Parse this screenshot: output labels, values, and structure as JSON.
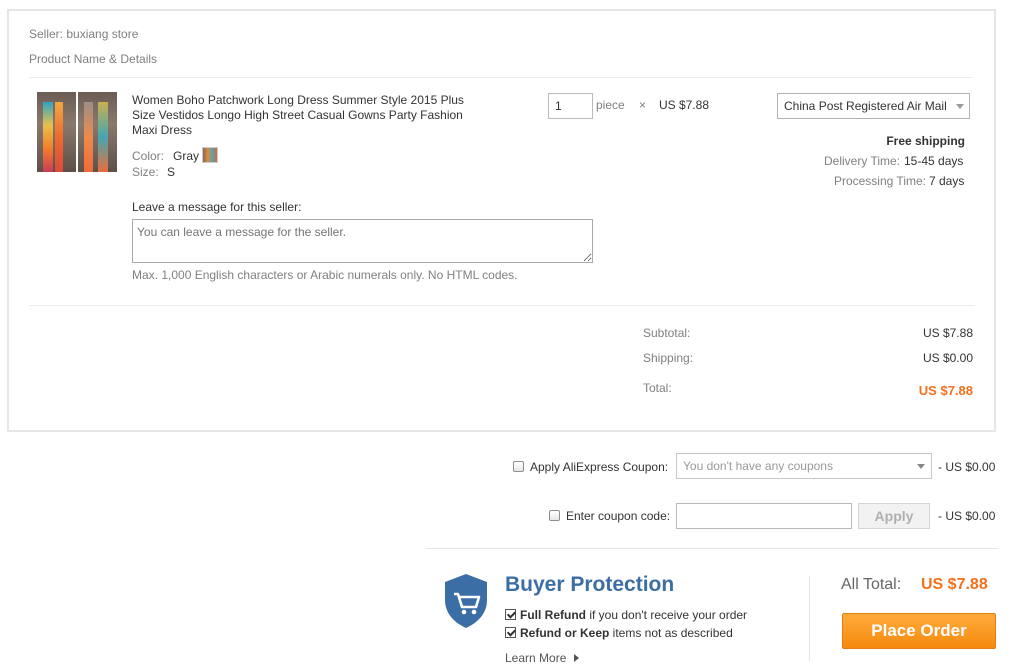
{
  "seller": {
    "label": "Seller: buxiang store"
  },
  "section": {
    "product_header": "Product Name & Details"
  },
  "product": {
    "title_lines": [
      "Women Boho Patchwork Long Dress Summer Style 2015 Plus",
      "Size Vestidos Longo High Street Casual Gowns Party Fashion",
      "Maxi Dress"
    ],
    "color_label": "Color:",
    "color_value": "Gray",
    "size_label": "Size:",
    "size_value": "S",
    "quantity": "1",
    "unit": "piece",
    "times": "×",
    "price": "US $7.88"
  },
  "shipping": {
    "method": "China Post Registered Air Mail",
    "free_text": "Free shipping",
    "delivery_label": "Delivery Time:",
    "delivery_value": "15-45 days",
    "processing_label": "Processing Time:",
    "processing_value": "7 days"
  },
  "message": {
    "label": "Leave a message for this seller:",
    "placeholder": "You can leave a message for the seller.",
    "note": "Max. 1,000 English characters or Arabic numerals only. No HTML codes."
  },
  "summary": {
    "subtotal_label": "Subtotal:",
    "subtotal_value": "US $7.88",
    "shipping_label": "Shipping:",
    "shipping_value": "US $0.00",
    "total_label": "Total:",
    "total_value": "US $7.88"
  },
  "coupon": {
    "aliexpress_label": "Apply AliExpress Coupon:",
    "aliexpress_select": "You don't have any coupons",
    "aliexpress_discount": "- US $0.00",
    "code_label": "Enter coupon code:",
    "code_value": "",
    "apply_label": "Apply",
    "code_discount": "- US $0.00"
  },
  "protection": {
    "title": "Buyer Protection",
    "line1_bold": "Full Refund",
    "line1_rest": " if you don't receive your order",
    "line2_bold": "Refund or Keep",
    "line2_rest": " items not as described",
    "learn_more": "Learn More"
  },
  "footer": {
    "all_total_label": "All Total:",
    "all_total_value": "US $7.88",
    "place_order": "Place Order"
  },
  "colors": {
    "accent": "#f4701b",
    "protection_blue": "#3b6ea5",
    "button_orange": "#f58a0d"
  }
}
